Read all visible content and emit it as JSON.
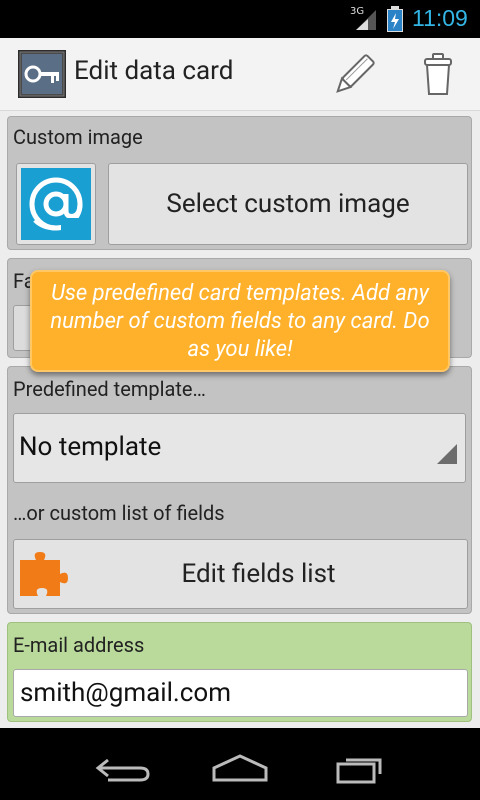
{
  "status_bar": {
    "network": "3G",
    "time": "11:09"
  },
  "action_bar": {
    "title": "Edit data card",
    "icons": [
      "key-icon",
      "pencil-icon",
      "trash-icon"
    ]
  },
  "custom_image": {
    "label": "Custom image",
    "button": "Select custom image",
    "icon": "at-sign-icon"
  },
  "partially_hidden": {
    "label_fragment": "Fa"
  },
  "tooltip": {
    "text": "Use predefined card templates. Add any number of custom fields to any card. Do as you like!"
  },
  "template": {
    "label": "Predefined template…",
    "selected": "No template",
    "custom_label": "…or custom list of fields",
    "edit_button": "Edit fields list"
  },
  "email": {
    "label": "E-mail address",
    "value": "smith@gmail.com"
  },
  "colors": {
    "accent_blue": "#33b5e5",
    "tooltip_orange": "#ffb12b",
    "email_panel_green": "#b9da9a",
    "puzzle_orange": "#f07b17"
  }
}
